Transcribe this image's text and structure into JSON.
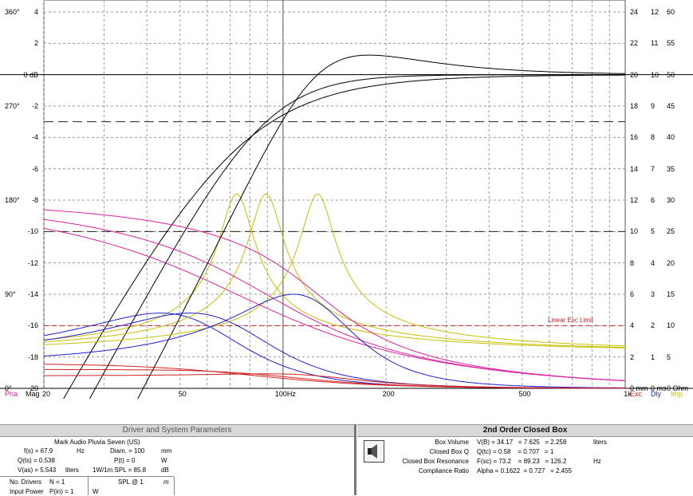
{
  "graph": {
    "left_axis_phase": [
      "360°",
      "270°",
      "180°",
      "90°",
      "0°"
    ],
    "left_axis_mag": [
      "4",
      "2",
      "0 dB",
      "-2",
      "-4",
      "-6",
      "-8",
      "-10",
      "-12",
      "-14",
      "-16",
      "-18",
      "-20"
    ],
    "right_axis_1": [
      "24",
      "22",
      "20",
      "18",
      "16",
      "14",
      "12",
      "10",
      "8",
      "6",
      "4",
      "2",
      "0 mm"
    ],
    "right_axis_2": [
      "12",
      "11",
      "10",
      "9",
      "8",
      "7",
      "6",
      "5",
      "4",
      "3",
      "2",
      "1",
      "0 ms"
    ],
    "right_axis_3": [
      "60",
      "55",
      "50",
      "45",
      "40",
      "35",
      "30",
      "25",
      "20",
      "15",
      "10",
      "5",
      "0 Ohm"
    ],
    "x_ticks": [
      "20",
      "50",
      "100Hz",
      "200",
      "500",
      "1k"
    ],
    "pha_label": "Pha",
    "mag_label": "Mag",
    "exc_label": "Exc",
    "dly_label": "Dly",
    "imp_label": "Imp",
    "linear_exc_limit": "Linear Exc Limit",
    "colors": {
      "phase": "#e020a0",
      "magnitude": "#000000",
      "excursion": "#d02020",
      "delay": "#2020d0",
      "impedance": "#c8c000",
      "grid": "#9a9a9a"
    }
  },
  "driver_panel": {
    "title": "Driver and System Parameters",
    "driver_name": "Mark Audio  Pluvia Seven (US)",
    "fs": "f(s) = 67.9",
    "fs_unit": "Hz",
    "diam": "Diam. = 100",
    "diam_unit": "mm",
    "qts": "Q(ts) = 0.538",
    "pt": "P(t) = 0",
    "pt_unit": "W",
    "vas": "V(as) = 5.543",
    "vas_unit": "liters",
    "spl1": "1W/1m SPL = 85.8",
    "spl1_unit": "dB",
    "no_drivers": "No. Drivers",
    "n": "N = 1",
    "spl_at": "SPL @ 1",
    "spl_at_unit": "m",
    "input_power": "Input Power",
    "pin": "P(in) = 1",
    "pin_unit": "W"
  },
  "box_panel": {
    "title": "2nd Order Closed Box",
    "rows": [
      {
        "label": "Box Volume",
        "values": "V(B) = 34.17   = 7.625   = 2.258",
        "unit": "liters"
      },
      {
        "label": "Closed Box Q",
        "values": "Q(tc) = 0.58    = 0.707   = 1",
        "unit": ""
      },
      {
        "label": "Closed Box Resonance",
        "values": "F(sc) = 73.2    = 89.23   = 126.2",
        "unit": "Hz"
      },
      {
        "label": "Compliance Ratio",
        "values": "Alpha = 0.1622  = 0.727   = 2.455",
        "unit": ""
      }
    ]
  }
}
